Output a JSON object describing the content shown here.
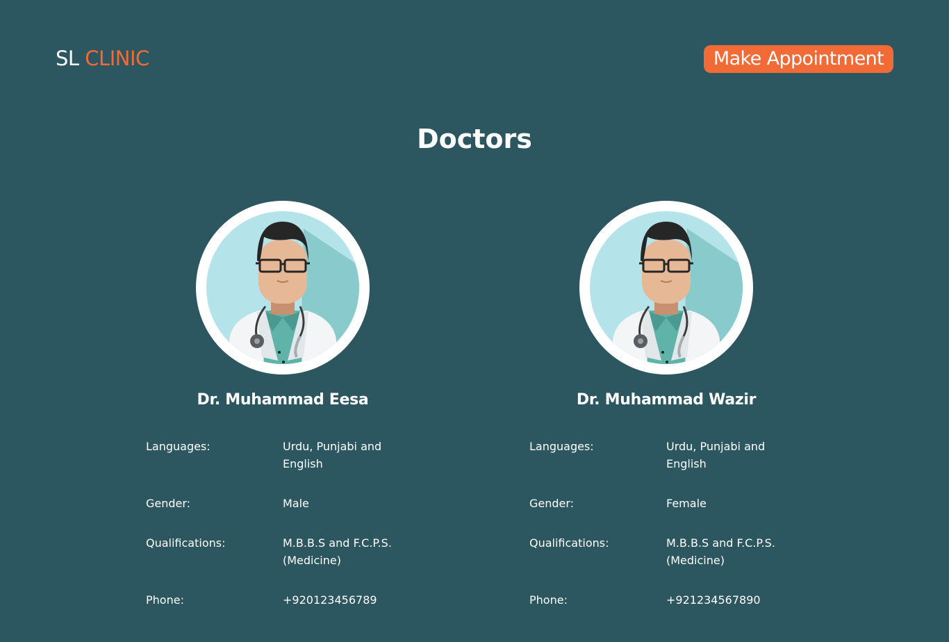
{
  "header": {
    "logo_first": "SL",
    "logo_second": "CLINIC",
    "appointment_button": "Make Appointment"
  },
  "page": {
    "title": "Doctors"
  },
  "labels": {
    "languages": "Languages:",
    "gender": "Gender:",
    "qualifications": "Qualifications:",
    "phone": "Phone:"
  },
  "doctors": [
    {
      "name": "Dr. Muhammad Eesa",
      "avatar_icon": "doctor-avatar-icon",
      "languages": "Urdu, Punjabi and English",
      "gender": "Male",
      "qualifications": "M.B.B.S and F.C.P.S. (Medicine)",
      "phone": "+920123456789"
    },
    {
      "name": "Dr. Muhammad Wazir",
      "avatar_icon": "doctor-avatar-icon",
      "languages": "Urdu, Punjabi and English",
      "gender": "Female",
      "qualifications": "M.B.B.S and F.C.P.S. (Medicine)",
      "phone": "+921234567890"
    }
  ],
  "colors": {
    "background": "#2d5760",
    "accent": "#f26a35",
    "text": "#ffffff"
  }
}
